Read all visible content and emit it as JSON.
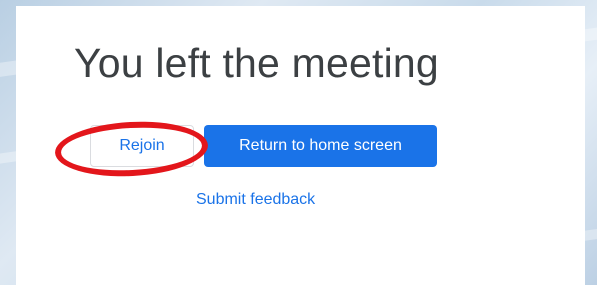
{
  "dialog": {
    "title": "You left the meeting",
    "rejoin_label": "Rejoin",
    "return_home_label": "Return to home screen",
    "feedback_label": "Submit feedback"
  },
  "colors": {
    "accent": "#1a73e8",
    "title_text": "#3c4043",
    "annotation": "#e3161b"
  }
}
